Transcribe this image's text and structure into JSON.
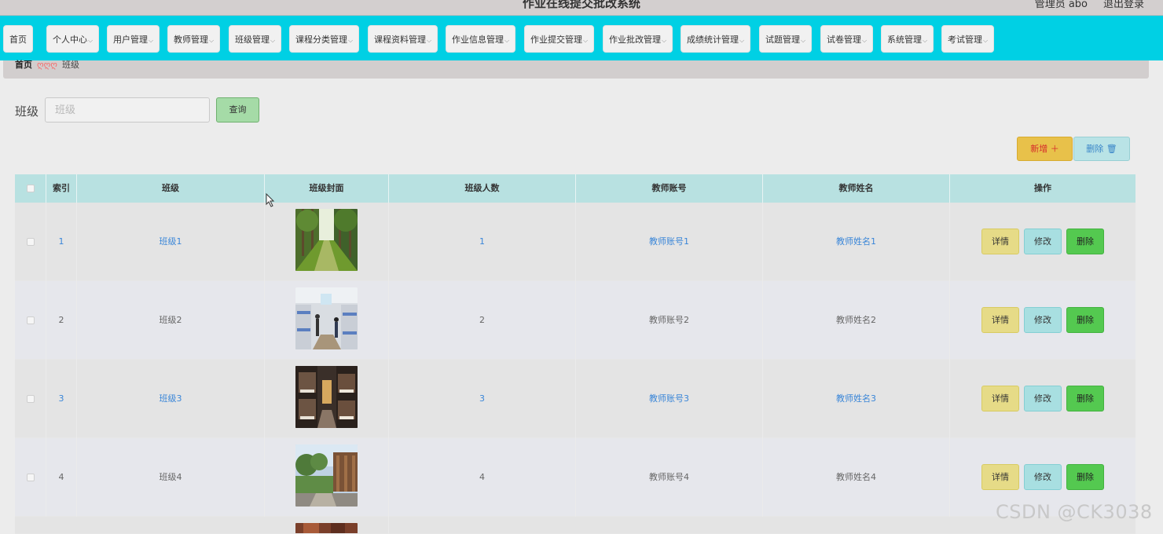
{
  "header": {
    "site_title": "作业在线提交批改系统",
    "user_label": "管理员 abo",
    "logout_label": "退出登录"
  },
  "nav": {
    "items": [
      {
        "label": "首页",
        "has_dropdown": false
      },
      {
        "label": "个人中心",
        "has_dropdown": true
      },
      {
        "label": "用户管理",
        "has_dropdown": true
      },
      {
        "label": "教师管理",
        "has_dropdown": true
      },
      {
        "label": "班级管理",
        "has_dropdown": true
      },
      {
        "label": "课程分类管理",
        "has_dropdown": true
      },
      {
        "label": "课程资料管理",
        "has_dropdown": true
      },
      {
        "label": "作业信息管理",
        "has_dropdown": true
      },
      {
        "label": "作业提交管理",
        "has_dropdown": true
      },
      {
        "label": "作业批改管理",
        "has_dropdown": true
      },
      {
        "label": "成绩统计管理",
        "has_dropdown": true
      },
      {
        "label": "试题管理",
        "has_dropdown": true
      },
      {
        "label": "试卷管理",
        "has_dropdown": true
      },
      {
        "label": "系统管理",
        "has_dropdown": true
      },
      {
        "label": "考试管理",
        "has_dropdown": true
      }
    ],
    "chevron": "⌵"
  },
  "breadcrumb": {
    "home": "首页",
    "separator": "ღღღ",
    "current": "班级"
  },
  "search": {
    "label": "班级",
    "placeholder": "班级",
    "value": "",
    "button_label": "查询"
  },
  "actions": {
    "add_label": "新增 ＋",
    "delete_label": "删除 🗑"
  },
  "table": {
    "columns": [
      "",
      "索引",
      "班级",
      "班级封面",
      "班级人数",
      "教师账号",
      "教师姓名",
      "操作"
    ],
    "rows": [
      {
        "index": "1",
        "class": "班级1",
        "cover": "tree-path",
        "count": "1",
        "teacher_account": "教师账号1",
        "teacher_name": "教师姓名1"
      },
      {
        "index": "2",
        "class": "班级2",
        "cover": "dorm-room",
        "count": "2",
        "teacher_account": "教师账号2",
        "teacher_name": "教师姓名2"
      },
      {
        "index": "3",
        "class": "班级3",
        "cover": "bunk-room",
        "count": "3",
        "teacher_account": "教师账号3",
        "teacher_name": "教师姓名3"
      },
      {
        "index": "4",
        "class": "班级4",
        "cover": "garden",
        "count": "4",
        "teacher_account": "教师账号4",
        "teacher_name": "教师姓名4"
      },
      {
        "index": "",
        "class": "",
        "cover": "partial",
        "count": "",
        "teacher_account": "",
        "teacher_name": ""
      }
    ],
    "row_buttons": {
      "detail": "详情",
      "edit": "修改",
      "delete": "删除"
    }
  },
  "watermark": "CSDN @CK3038",
  "colors": {
    "navbar": "#00d0e4",
    "header_row": "#b8e1e1",
    "link_blue": "#3a86d8",
    "add_button": "#e8c14a",
    "delete_button": "#54c950"
  }
}
